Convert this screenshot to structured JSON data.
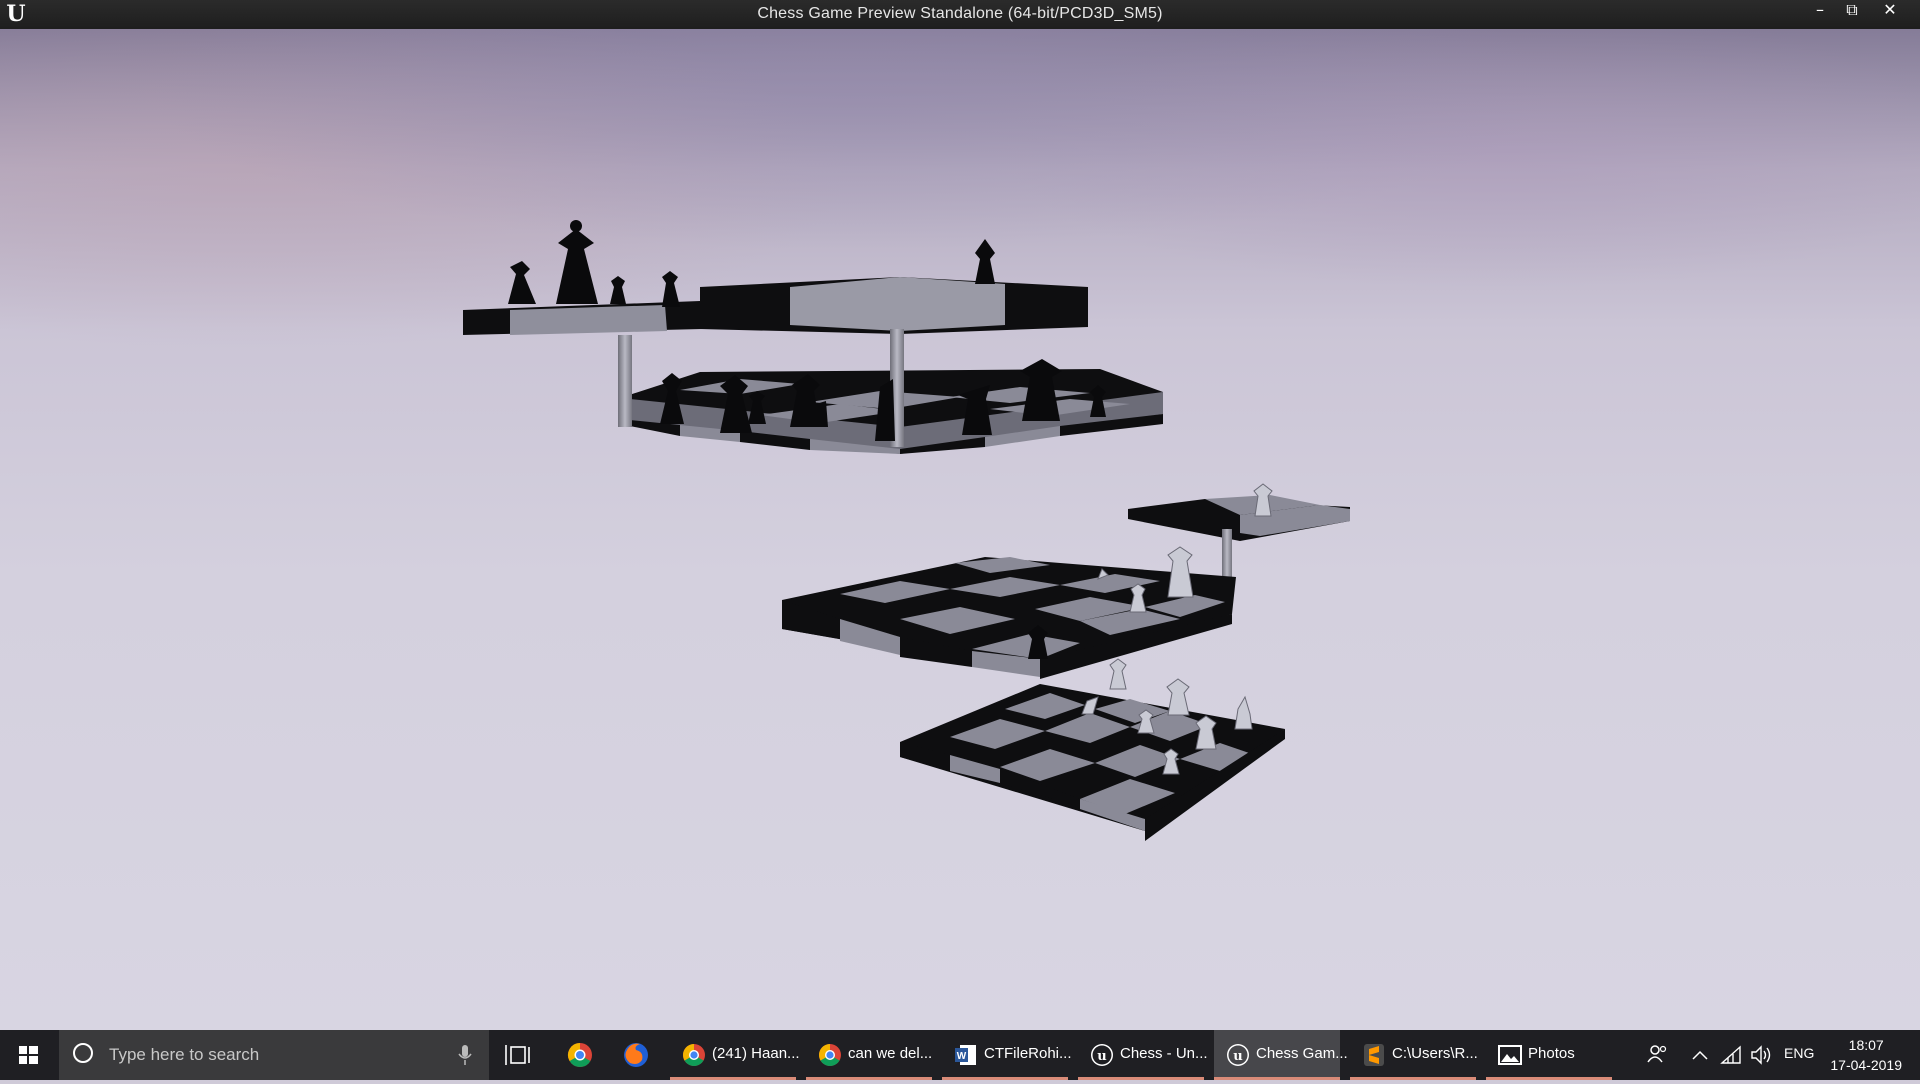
{
  "window": {
    "title": "Chess Game Preview Standalone (64-bit/PCD3D_SM5)",
    "logo": "U",
    "minimize_glyph": "–",
    "restore_glyph": "⧉",
    "close_glyph": "✕"
  },
  "taskbar": {
    "search_placeholder": "Type here to search",
    "apps": [
      {
        "label": "(241) Haan...",
        "icon": "chrome-icon",
        "open": true,
        "active": false
      },
      {
        "label": "can we del...",
        "icon": "chrome-icon",
        "open": true,
        "active": false
      },
      {
        "label": "CTFileRohi...",
        "icon": "word-icon",
        "open": true,
        "active": false
      },
      {
        "label": "Chess - Un...",
        "icon": "unreal-icon",
        "open": true,
        "active": false
      },
      {
        "label": "Chess Gam...",
        "icon": "unreal-icon",
        "open": true,
        "active": true
      },
      {
        "label": "C:\\Users\\R...",
        "icon": "sublime-icon",
        "open": true,
        "active": false
      },
      {
        "label": "Photos",
        "icon": "photos-icon",
        "open": true,
        "active": false
      }
    ],
    "tray": {
      "language": "ENG",
      "time": "18:07",
      "date": "17-04-2019"
    }
  },
  "colors": {
    "board_dark": "#0d0d0f",
    "board_light": "#8a8a97",
    "accent_underline": "#d98b78"
  }
}
